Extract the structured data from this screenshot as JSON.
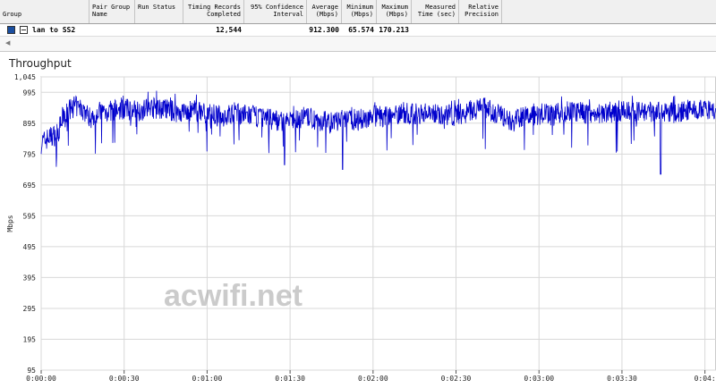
{
  "table": {
    "headers": [
      {
        "label": "Group",
        "x": 0,
        "w": 100,
        "align": "l"
      },
      {
        "label": "Pair Group\nName",
        "x": 100,
        "w": 51,
        "align": "l"
      },
      {
        "label": "Run Status",
        "x": 151,
        "w": 54,
        "align": "l"
      },
      {
        "label": "Timing Records\nCompleted",
        "x": 205,
        "w": 68,
        "align": "r"
      },
      {
        "label": "95% Confidence\nInterval",
        "x": 273,
        "w": 70,
        "align": "r"
      },
      {
        "label": "Average\n(Mbps)",
        "x": 343,
        "w": 39,
        "align": "r"
      },
      {
        "label": "Minimum\n(Mbps)",
        "x": 382,
        "w": 39,
        "align": "r"
      },
      {
        "label": "Maximum\n(Mbps)",
        "x": 421,
        "w": 39,
        "align": "r"
      },
      {
        "label": "Measured\nTime (sec)",
        "x": 460,
        "w": 53,
        "align": "r"
      },
      {
        "label": "Relative\nPrecision",
        "x": 513,
        "w": 48,
        "align": "r"
      }
    ],
    "row": {
      "group": "lan to SS2",
      "records": "12,544",
      "average": "912.300",
      "minimum": "65.574",
      "maximum": "170.213"
    }
  },
  "chart_data": {
    "type": "line",
    "title": "Throughput",
    "ylabel": "Mbps",
    "xlabel": "",
    "ylim": [
      95,
      1045
    ],
    "y_ticks": [
      "1,045",
      "995",
      "895",
      "795",
      "695",
      "595",
      "495",
      "395",
      "295",
      "195",
      "95"
    ],
    "x_ticks": [
      "0:00:00",
      "0:00:30",
      "0:01:00",
      "0:01:30",
      "0:02:00",
      "0:02:30",
      "0:03:00",
      "0:03:30",
      "0:04:"
    ],
    "xlim_seconds": [
      0,
      244
    ],
    "grid": true,
    "series": [
      {
        "color": "#0000cc",
        "x": [
          0,
          3,
          6,
          8,
          12,
          15,
          18,
          20,
          25,
          30,
          35,
          40,
          45,
          50,
          55,
          60,
          65,
          70,
          75,
          80,
          85,
          90,
          95,
          100,
          105,
          110,
          115,
          120,
          125,
          130,
          135,
          140,
          145,
          150,
          155,
          160,
          165,
          170,
          175,
          180,
          185,
          190,
          195,
          200,
          205,
          210,
          215,
          220,
          225,
          230,
          235,
          240,
          244
        ],
        "y": [
          830,
          850,
          860,
          920,
          950,
          940,
          910,
          930,
          935,
          940,
          935,
          945,
          940,
          930,
          935,
          930,
          915,
          925,
          920,
          915,
          905,
          900,
          915,
          905,
          895,
          910,
          905,
          920,
          915,
          930,
          925,
          930,
          925,
          920,
          935,
          945,
          925,
          900,
          915,
          925,
          920,
          935,
          930,
          925,
          930,
          935,
          930,
          935,
          925,
          930,
          940,
          935,
          930
        ]
      }
    ]
  },
  "watermark": "acwifi.net"
}
